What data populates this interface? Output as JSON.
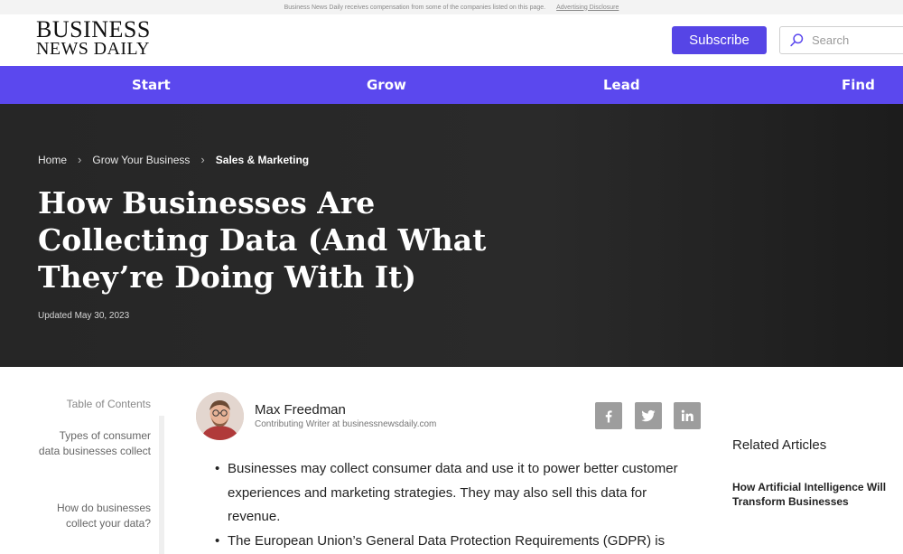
{
  "disclosure": {
    "text": "Business News Daily receives compensation from some of the companies listed on this page.",
    "link": "Advertising Disclosure"
  },
  "header": {
    "logo_line1": "BUSINESS",
    "logo_line2": "NEWS DAILY",
    "subscribe_label": "Subscribe",
    "search_placeholder": "Search"
  },
  "nav": {
    "items": [
      {
        "label": "Start"
      },
      {
        "label": "Grow"
      },
      {
        "label": "Lead"
      },
      {
        "label": "Find"
      }
    ]
  },
  "hero": {
    "breadcrumb": [
      {
        "label": "Home"
      },
      {
        "label": "Grow Your Business"
      },
      {
        "label": "Sales & Marketing"
      }
    ],
    "title": "How Businesses Are Collecting Data (And What They’re Doing With It)",
    "updated": "Updated May 30, 2023"
  },
  "toc": {
    "title": "Table of Contents",
    "items": [
      {
        "label": "Types of consumer data businesses collect"
      },
      {
        "label": "How do businesses collect your data?"
      }
    ]
  },
  "author": {
    "name": "Max Freedman",
    "role": "Contributing Writer at businessnewsdaily.com"
  },
  "share": {
    "icons": [
      "facebook-icon",
      "twitter-icon",
      "linkedin-icon"
    ]
  },
  "article": {
    "bullets": [
      "Businesses may collect consumer data and use it to power better customer experiences and marketing strategies. They may also sell this data for revenue.",
      "The European Union’s General Data Protection Requirements (GDPR) is"
    ]
  },
  "related": {
    "title": "Related Articles",
    "items": [
      {
        "label": "How Artificial Intelligence Will Transform Businesses"
      }
    ]
  },
  "colors": {
    "brand": "#5b48ee",
    "subscribe": "#5645e6",
    "hero_bg": "#262626",
    "share_icon_bg": "#9d9d9d"
  }
}
